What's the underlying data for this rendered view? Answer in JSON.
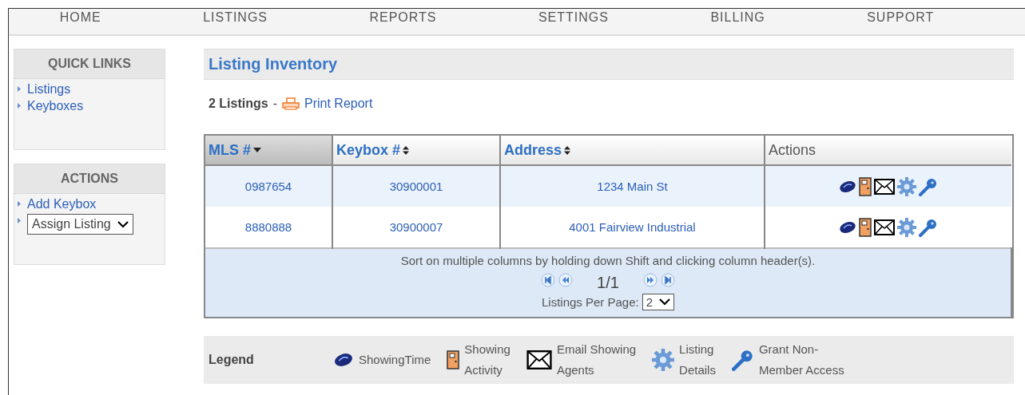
{
  "nav": [
    {
      "label": "HOME",
      "selected": false
    },
    {
      "label": "LISTINGS",
      "selected": false
    },
    {
      "label": "REPORTS",
      "selected": false
    },
    {
      "label": "SETTINGS",
      "selected": false
    },
    {
      "label": "BILLING",
      "selected": false
    },
    {
      "label": "SUPPORT",
      "selected": false
    }
  ],
  "sidebar": [
    {
      "title": "QUICK LINKS",
      "items": [
        {
          "kind": "link",
          "label": "Listings"
        },
        {
          "kind": "link",
          "label": "Keyboxes"
        }
      ]
    },
    {
      "title": "ACTIONS",
      "items": [
        {
          "kind": "link",
          "label": "Add Keybox"
        },
        {
          "kind": "select",
          "label": "Assign Listing"
        }
      ]
    }
  ],
  "page_title": "Listing Inventory",
  "count": "2 Listings",
  "count_sep": "-",
  "print_link": "Print Report",
  "table": {
    "columns": [
      {
        "label": "MLS #",
        "kind": "sorted_desc",
        "selected": true
      },
      {
        "label": "Keybox #",
        "kind": "sortable",
        "selected": false
      },
      {
        "label": "Address",
        "kind": "sortable",
        "selected": false
      },
      {
        "label": "Actions",
        "kind": "plain",
        "selected": false
      }
    ],
    "rows": [
      {
        "cells": [
          "0987654",
          "30900001",
          "1234 Main St"
        ],
        "actions": [
          {
            "kind": "showingtime"
          },
          {
            "kind": "door"
          },
          {
            "kind": "envelope"
          },
          {
            "kind": "gear"
          },
          {
            "kind": "key"
          }
        ],
        "selected": true
      },
      {
        "cells": [
          "8880888",
          "30900007",
          "4001 Fairview Industrial"
        ],
        "actions": [
          {
            "kind": "showingtime"
          },
          {
            "kind": "door"
          },
          {
            "kind": "envelope"
          },
          {
            "kind": "gear"
          },
          {
            "kind": "key"
          }
        ],
        "selected": false
      }
    ],
    "hint": "Sort on multiple columns by holding down Shift and clicking column header(s).",
    "page": "1/1",
    "per_page_label": "Listings Per Page:",
    "per_page": "2"
  },
  "legend": {
    "title": "Legend",
    "items": [
      {
        "kind": "showingtime",
        "lines": [
          "ShowingTime"
        ]
      },
      {
        "kind": "door",
        "lines": [
          "Showing",
          "Activity"
        ]
      },
      {
        "kind": "envelope",
        "lines": [
          "Email Showing",
          "Agents"
        ]
      },
      {
        "kind": "gear",
        "lines": [
          "Listing",
          "Details"
        ]
      },
      {
        "kind": "key",
        "lines": [
          "Grant Non-",
          "Member Access"
        ]
      }
    ]
  }
}
